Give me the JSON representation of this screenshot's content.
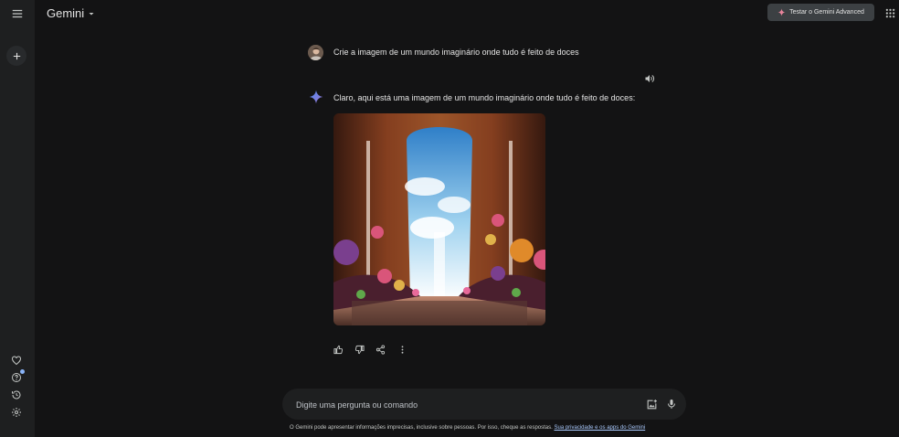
{
  "header": {
    "brand": "Gemini",
    "advanced_button": "Testar o Gemini Advanced"
  },
  "conversation": {
    "user_prompt": "Crie a imagem de um mundo imaginário onde tudo é feito de doces",
    "model_response": "Claro, aqui está uma imagem de um mundo imaginário onde tudo é feito de doces:"
  },
  "input": {
    "placeholder": "Digite uma pergunta ou comando"
  },
  "footer": {
    "disclaimer": "O Gemini pode apresentar informações imprecisas, inclusive sobre pessoas. Por isso, cheque as respostas.",
    "privacy_link": "Sua privacidade e os apps do Gemini"
  },
  "icons": {
    "menu": "menu-icon",
    "new_chat": "plus-icon",
    "dropdown": "arrow-drop-down-icon",
    "sparkle": "sparkle-icon",
    "apps": "apps-grid-icon",
    "speaker": "volume-icon",
    "gemini": "gemini-star-icon",
    "like": "thumb-up-icon",
    "dislike": "thumb-down-icon",
    "share": "share-icon",
    "more": "more-vert-icon",
    "upload_image": "add-photo-icon",
    "mic": "mic-icon",
    "gem_manager": "gem-icon",
    "help": "help-icon",
    "activity": "history-icon",
    "settings": "settings-icon"
  },
  "colors": {
    "background": "#131314",
    "sidebar": "#1e1f20",
    "accent_blue": "#4285f4",
    "sparkle_pink": "#e8849b"
  }
}
